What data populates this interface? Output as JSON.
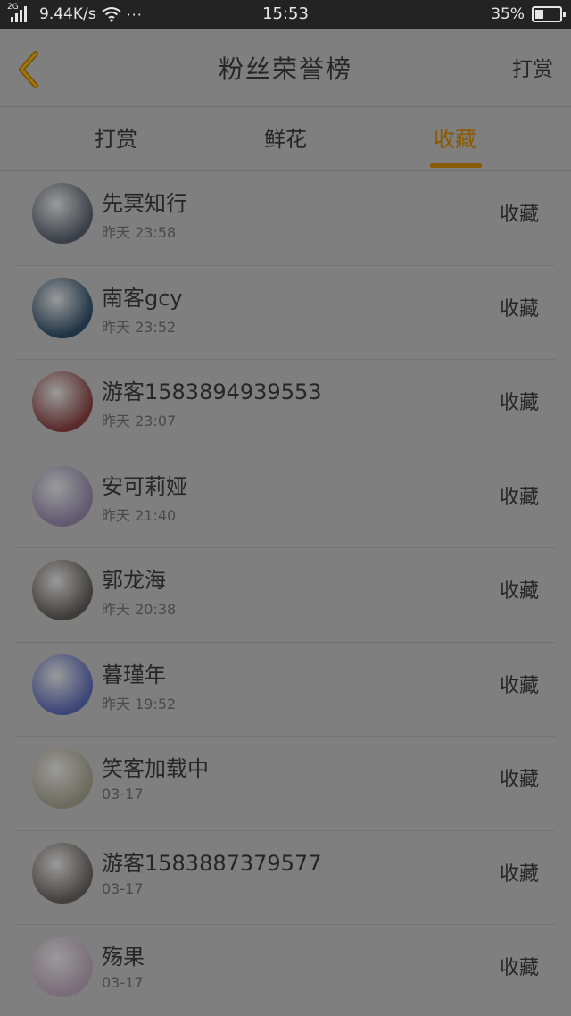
{
  "status_bar": {
    "network": "2G",
    "speed": "9.44K/s",
    "more": "···",
    "time": "15:53",
    "battery_text": "35%",
    "battery_level": 0.35
  },
  "header": {
    "title": "粉丝荣誉榜",
    "action": "打赏"
  },
  "tabs": [
    {
      "label": "打赏",
      "active": false
    },
    {
      "label": "鲜花",
      "active": false
    },
    {
      "label": "收藏",
      "active": true
    }
  ],
  "colors": {
    "accent": "#8a5a00",
    "overlay_bg": "#7f7f7f",
    "status_bar": "#232323"
  },
  "list": [
    {
      "name": "先冥知行",
      "time": "昨天 23:58",
      "action": "收藏",
      "avatar_color": "#3a3f48"
    },
    {
      "name": "南客gcy",
      "time": "昨天 23:52",
      "action": "收藏",
      "avatar_color": "#1e3344"
    },
    {
      "name": "游客1583894939553",
      "time": "昨天 23:07",
      "action": "收藏",
      "avatar_color": "#5a2a2a"
    },
    {
      "name": "安可莉娅",
      "time": "昨天 21:40",
      "action": "收藏",
      "avatar_color": "#5f5a70"
    },
    {
      "name": "郭龙海",
      "time": "昨天 20:38",
      "action": "收藏",
      "avatar_color": "#3e3b3a"
    },
    {
      "name": "暮瑾年",
      "time": "昨天 19:52",
      "action": "收藏",
      "avatar_color": "#3b4578"
    },
    {
      "name": "笑客加载中",
      "time": "03-17",
      "action": "收藏",
      "avatar_color": "#6b6a5c"
    },
    {
      "name": "游客1583887379577",
      "time": "03-17",
      "action": "收藏",
      "avatar_color": "#44403f"
    },
    {
      "name": "殇果",
      "time": "03-17",
      "action": "收藏",
      "avatar_color": "#7a6c78"
    }
  ]
}
